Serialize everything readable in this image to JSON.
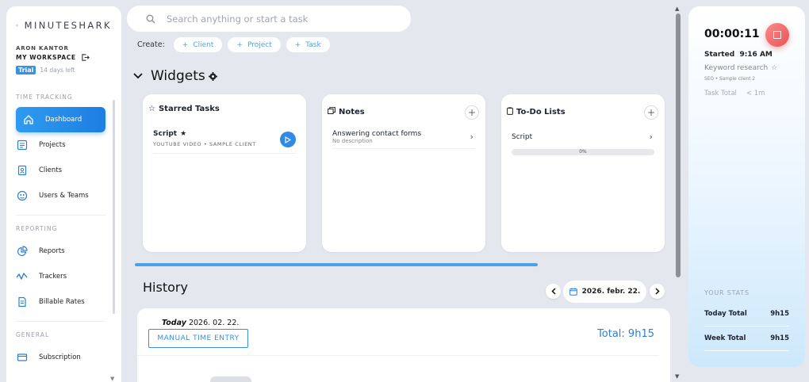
{
  "app": {
    "name": "MINUTESHARK"
  },
  "user": {
    "name": "ARON KANTOR",
    "workspace": "MY WORKSPACE",
    "trial_badge": "Trial",
    "trial_left": "14 days left"
  },
  "sidebar": {
    "sections": [
      {
        "label": "TIME TRACKING",
        "items": [
          {
            "label": "Dashboard",
            "icon": "home-icon",
            "active": true
          },
          {
            "label": "Projects",
            "icon": "projects-icon"
          },
          {
            "label": "Clients",
            "icon": "clients-icon"
          },
          {
            "label": "Users & Teams",
            "icon": "users-icon"
          }
        ]
      },
      {
        "label": "REPORTING",
        "items": [
          {
            "label": "Reports",
            "icon": "pie-chart-icon"
          },
          {
            "label": "Trackers",
            "icon": "trackers-icon"
          },
          {
            "label": "Billable Rates",
            "icon": "billable-icon"
          }
        ]
      },
      {
        "label": "GENERAL",
        "items": [
          {
            "label": "Subscription",
            "icon": "card-icon"
          }
        ]
      }
    ]
  },
  "search": {
    "placeholder": "Search anything or start a task"
  },
  "create": {
    "label": "Create:",
    "chips": [
      "Client",
      "Project",
      "Task"
    ]
  },
  "widgets": {
    "title": "Widgets",
    "starred": {
      "title": "Starred Tasks",
      "task_name": "Script",
      "task_sub": "YOUTUBE VIDEO • SAMPLE CLIENT"
    },
    "notes": {
      "title": "Notes",
      "note_title": "Answering contact forms",
      "note_sub": "No description"
    },
    "todo": {
      "title": "To-Do Lists",
      "list_name": "Script",
      "progress_label": "0%",
      "progress_value": 0
    }
  },
  "history": {
    "title": "History",
    "date": "2026. febr. 22.",
    "day_prefix": "Today",
    "day_date": "2026. 02. 22.",
    "manual_button": "MANUAL TIME ENTRY",
    "total": "Total: 9h15"
  },
  "timer": {
    "elapsed": "00:00:11",
    "started_label": "Started",
    "started_time": "9:16 AM",
    "task": "Keyword research",
    "project_client": "SEO • Sample client 2",
    "task_total_label": "Task Total",
    "task_total_value": "< 1m"
  },
  "stats": {
    "label": "YOUR STATS",
    "today_label": "Today Total",
    "today_value": "9h15",
    "week_label": "Week Total",
    "week_value": "9h15"
  },
  "colors": {
    "accent": "#2f8be6",
    "stop": "#e85454",
    "total": "#2f7fcf"
  }
}
